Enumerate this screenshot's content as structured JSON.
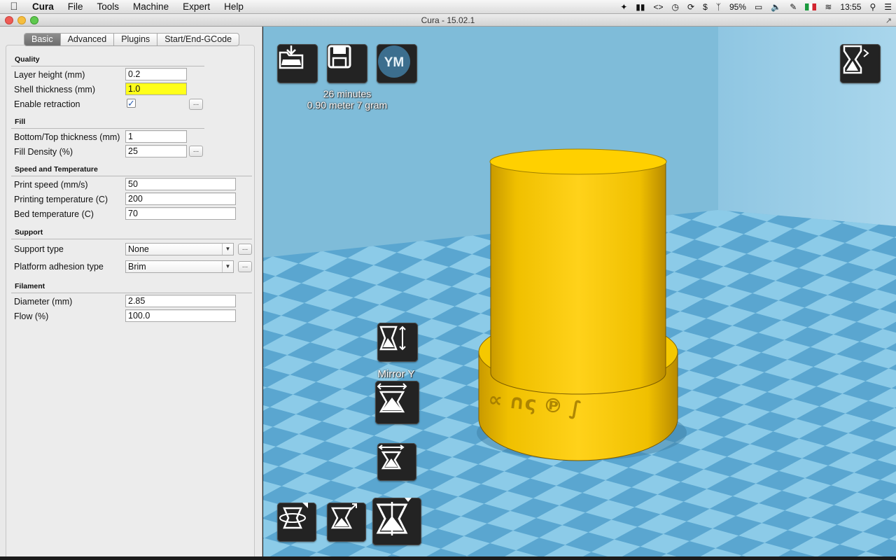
{
  "menubar": {
    "app_name": "Cura",
    "items": [
      "File",
      "Tools",
      "Machine",
      "Expert",
      "Help"
    ],
    "battery": "95%",
    "clock": "13:55"
  },
  "window": {
    "title": "Cura - 15.02.1"
  },
  "tabs": [
    "Basic",
    "Advanced",
    "Plugins",
    "Start/End-GCode"
  ],
  "quality": {
    "title": "Quality",
    "layer_height": {
      "label": "Layer height (mm)",
      "value": "0.2"
    },
    "shell_thickness": {
      "label": "Shell thickness (mm)",
      "value": "1.0"
    },
    "retraction": {
      "label": "Enable retraction",
      "checked": true
    }
  },
  "fill": {
    "title": "Fill",
    "bottom_top": {
      "label": "Bottom/Top thickness (mm)",
      "value": "1"
    },
    "density": {
      "label": "Fill Density (%)",
      "value": "25"
    }
  },
  "speed": {
    "title": "Speed and Temperature",
    "print_speed": {
      "label": "Print speed (mm/s)",
      "value": "50"
    },
    "print_temp": {
      "label": "Printing temperature (C)",
      "value": "200"
    },
    "bed_temp": {
      "label": "Bed temperature (C)",
      "value": "70"
    }
  },
  "support": {
    "title": "Support",
    "type": {
      "label": "Support type",
      "value": "None"
    },
    "adhesion": {
      "label": "Platform adhesion type",
      "value": "Brim"
    }
  },
  "filament": {
    "title": "Filament",
    "diameter": {
      "label": "Diameter (mm)",
      "value": "2.85"
    },
    "flow": {
      "label": "Flow (%)",
      "value": "100.0"
    }
  },
  "dots_label": "...",
  "viewport": {
    "ym_label": "YM",
    "print_time": "26 minutes",
    "print_material": "0.90 meter 7 gram",
    "mirror_label": "Mirror Y"
  },
  "colors": {
    "model": "#f2c200",
    "bed_light": "#8ccbe8",
    "bed_dark": "#5aa6d0",
    "highlight_field": "#ffff1a"
  }
}
